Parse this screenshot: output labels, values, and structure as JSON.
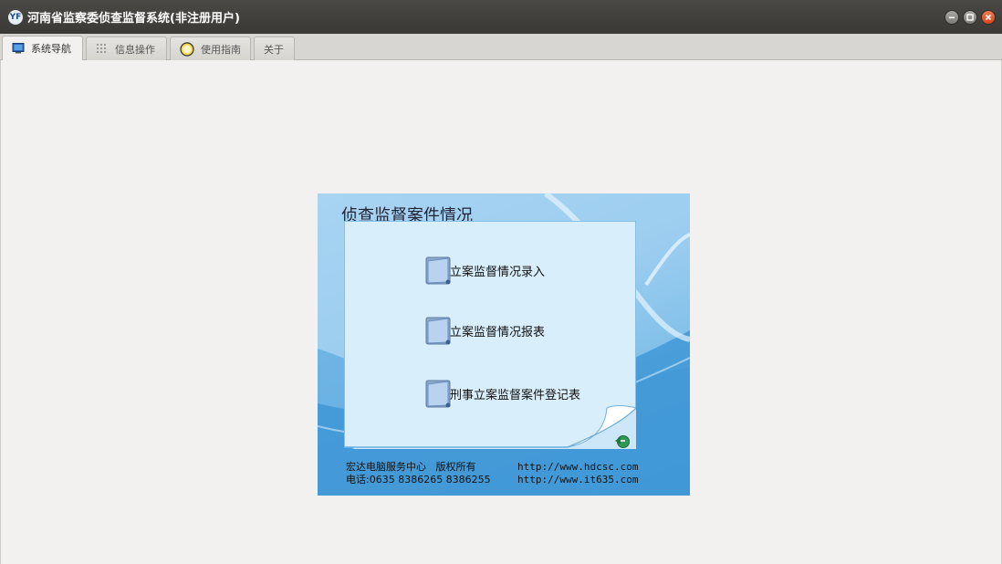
{
  "window": {
    "title": "河南省监察委侦查监督系统(非注册用户)",
    "logo_text": "YF",
    "controls": [
      "minimize-icon",
      "maximize-icon",
      "close-icon"
    ]
  },
  "tabs": [
    {
      "label": "系统导航",
      "icon": "monitor-icon",
      "active": true
    },
    {
      "label": "信息操作",
      "icon": "grid-icon",
      "active": false
    },
    {
      "label": "使用指南",
      "icon": "smiley-icon",
      "active": false
    },
    {
      "label": "关于",
      "active": false
    }
  ],
  "panel": {
    "title": "侦查监督案件情况",
    "items": [
      {
        "label": "立案监督情况录入",
        "icon": "folder-icon"
      },
      {
        "label": "立案监督情况报表",
        "icon": "folder-icon"
      },
      {
        "label": "刑事立案监督案件登记表",
        "icon": "folder-icon"
      }
    ],
    "back_icon": "back-arrow-icon",
    "footer": {
      "company": "宏达电脑服务中心   版权所有",
      "phone": "电话:0635 8386265 8386255",
      "url1": "http://www.hdcsc.com",
      "url2": "http://www.it635.com"
    }
  },
  "colors": {
    "titlebar": "#3f3e3a",
    "panel_light": "#a8d4f2",
    "panel_dark": "#3f99d8",
    "note": "#d9eefb"
  }
}
